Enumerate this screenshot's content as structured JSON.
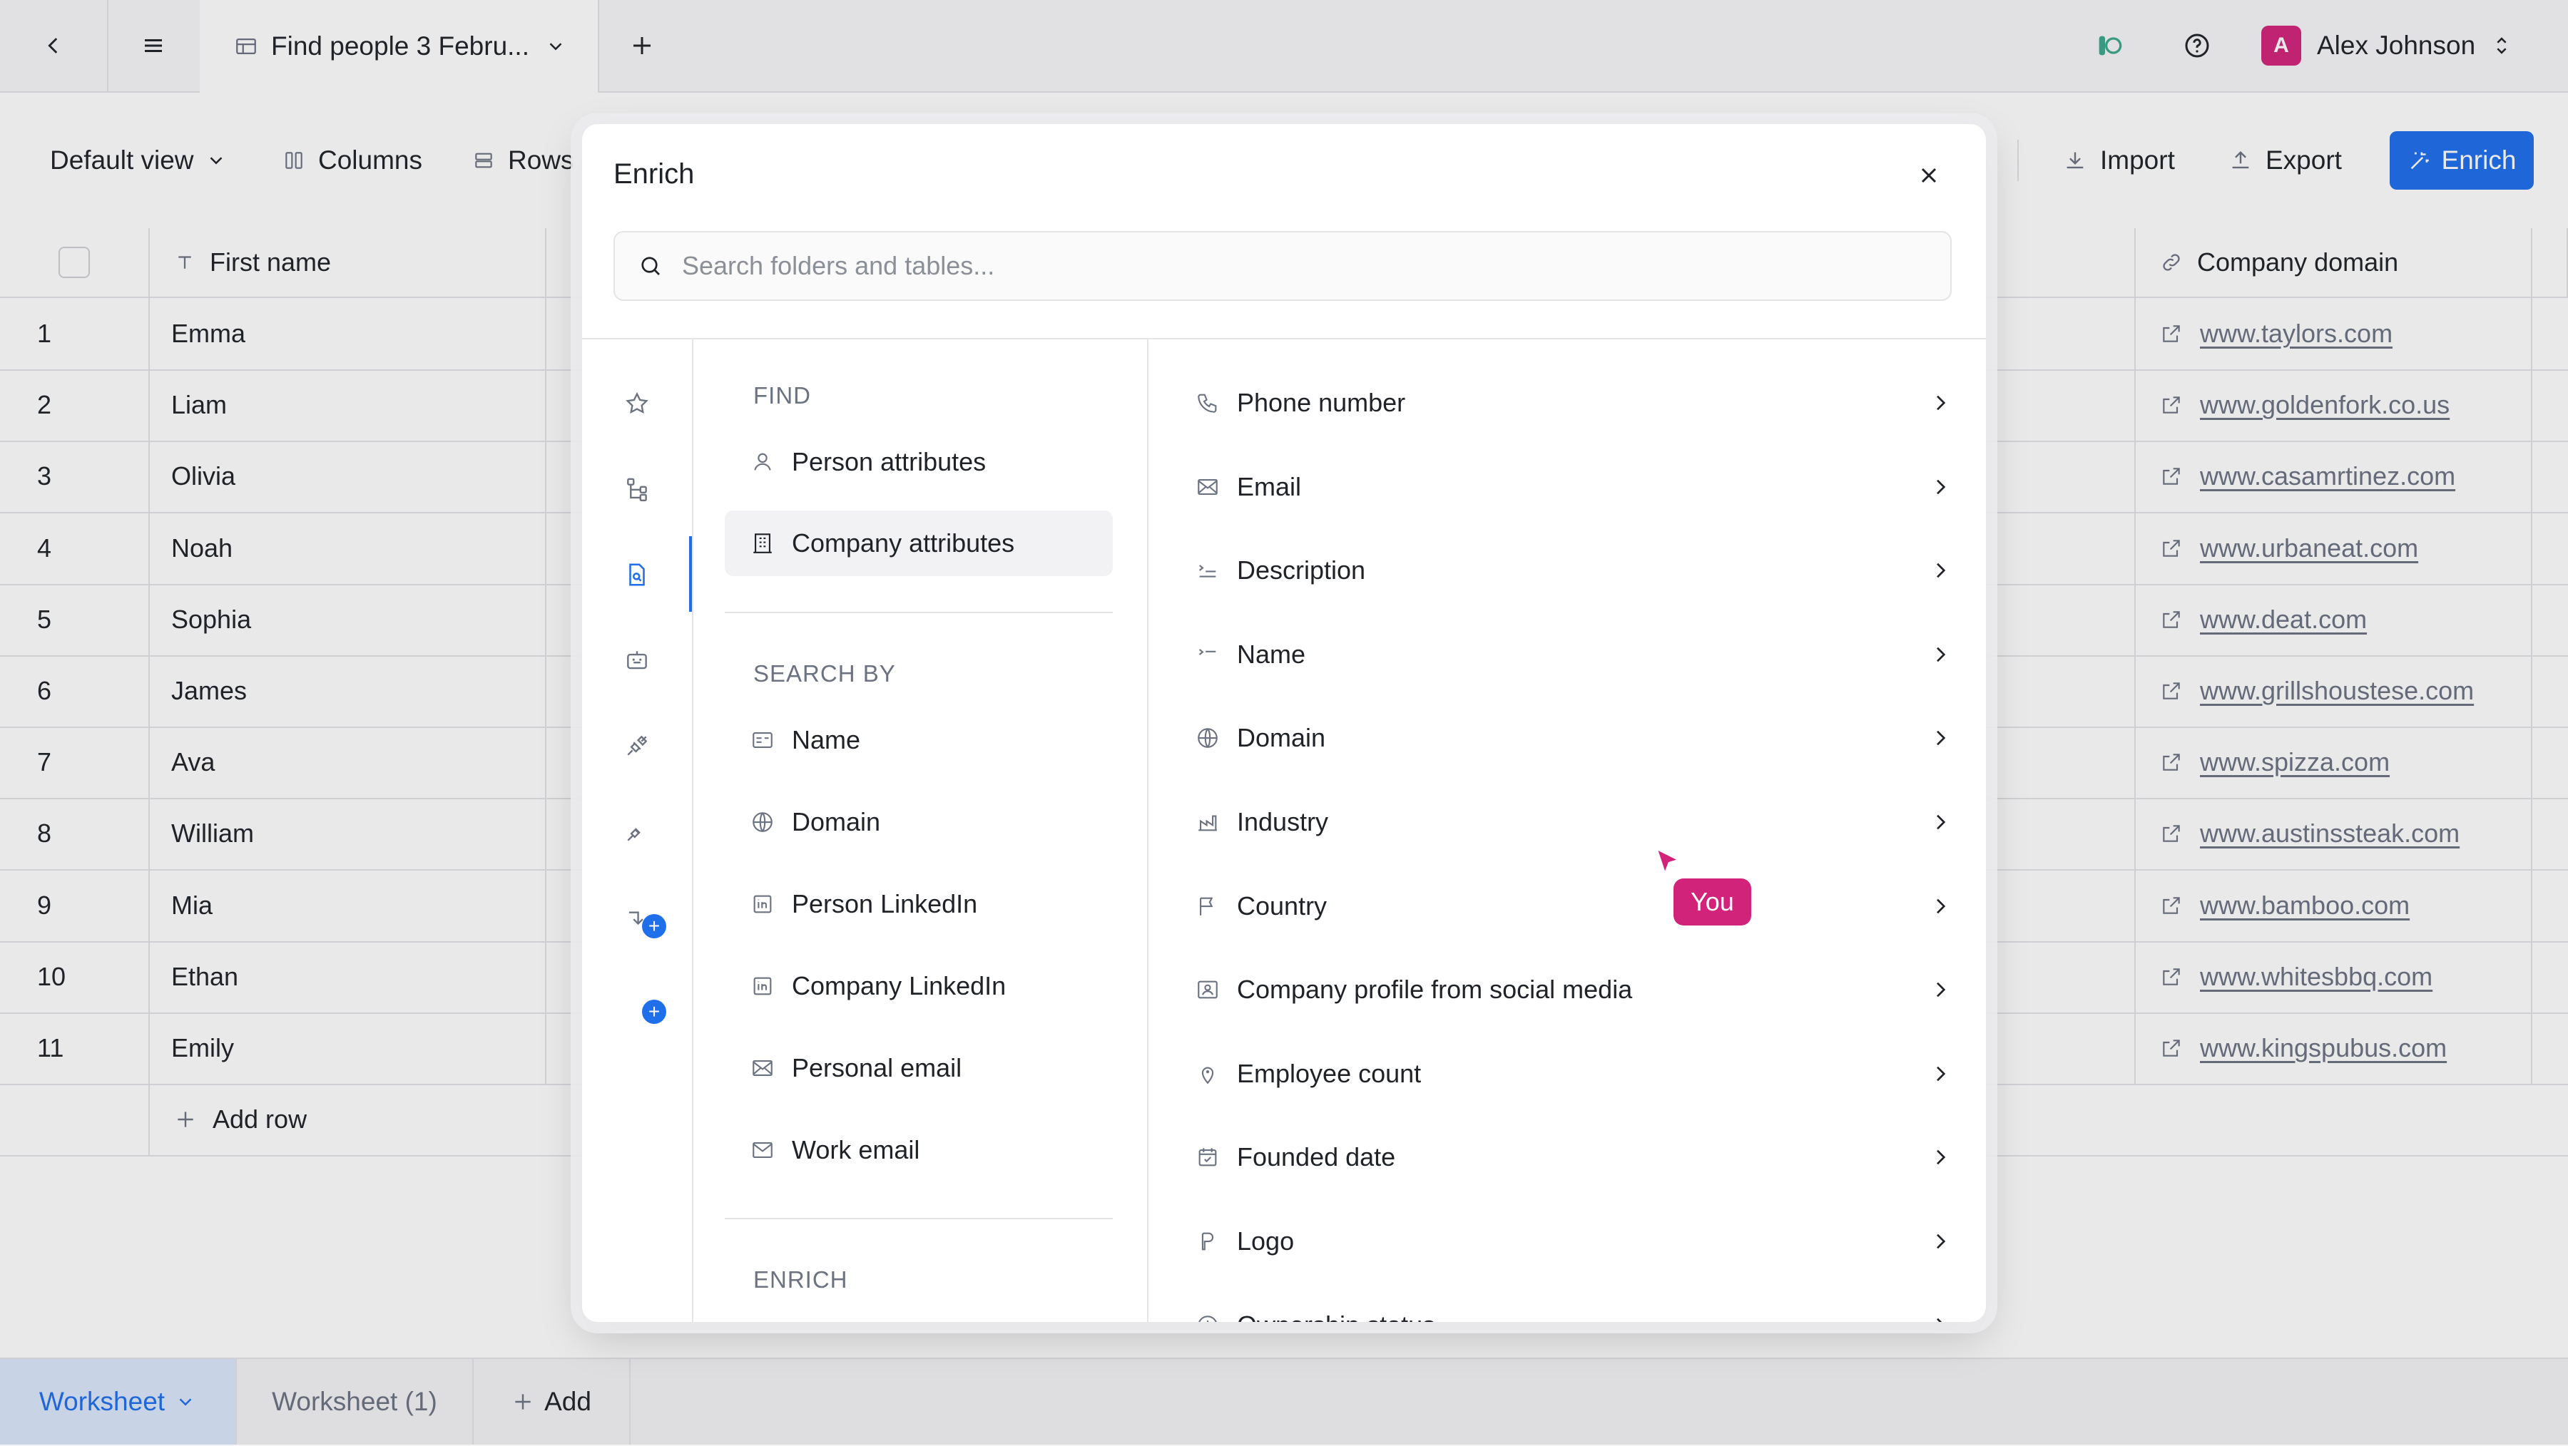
{
  "topbar": {
    "tab_title": "Find people 3 Febru...",
    "user_name": "Alex Johnson",
    "user_initial": "A"
  },
  "toolbar": {
    "view_label": "Default view",
    "columns_label": "Columns",
    "rows_label": "Rows",
    "import_label": "Import",
    "export_label": "Export",
    "enrich_label": "Enrich"
  },
  "grid": {
    "col_first_name": "First name",
    "col_company_domain": "Company domain",
    "rows": [
      {
        "num": "1",
        "first_name": "Emma",
        "domain": "www.taylors.com"
      },
      {
        "num": "2",
        "first_name": "Liam",
        "domain": "www.goldenfork.co.us"
      },
      {
        "num": "3",
        "first_name": "Olivia",
        "domain": "www.casamrtinez.com"
      },
      {
        "num": "4",
        "first_name": "Noah",
        "domain": "www.urbaneat.com"
      },
      {
        "num": "5",
        "first_name": "Sophia",
        "domain": "www.deat.com"
      },
      {
        "num": "6",
        "first_name": "James",
        "domain": "www.grillshoustese.com"
      },
      {
        "num": "7",
        "first_name": "Ava",
        "domain": "www.spizza.com"
      },
      {
        "num": "8",
        "first_name": "William",
        "domain": "www.austinssteak.com"
      },
      {
        "num": "9",
        "first_name": "Mia",
        "domain": "www.bamboo.com"
      },
      {
        "num": "10",
        "first_name": "Ethan",
        "domain": "www.whitesbbq.com"
      },
      {
        "num": "11",
        "first_name": "Emily",
        "domain": "www.kingspubus.com"
      }
    ],
    "add_row_label": "Add row"
  },
  "bottom": {
    "sheet_active": "Worksheet",
    "sheet_2": "Worksheet (1)",
    "add_label": "Add"
  },
  "modal": {
    "title": "Enrich",
    "search_placeholder": "Search folders and tables...",
    "find_heading": "FIND",
    "find_items": [
      "Person attributes",
      "Company attributes"
    ],
    "search_by_heading": "SEARCH BY",
    "search_by_items": [
      "Name",
      "Domain",
      "Person LinkedIn",
      "Company LinkedIn",
      "Personal email",
      "Work email"
    ],
    "enrich_heading": "ENRICH",
    "options": [
      "Phone number",
      "Email",
      "Description",
      "Name",
      "Domain",
      "Industry",
      "Country",
      "Company profile from social media",
      "Employee count",
      "Founded date",
      "Logo",
      "Ownership status"
    ]
  },
  "cursor": {
    "label": "You",
    "color": "#d2237a"
  },
  "colors": {
    "accent": "#1f6feb",
    "avatar": "#d2237a"
  }
}
